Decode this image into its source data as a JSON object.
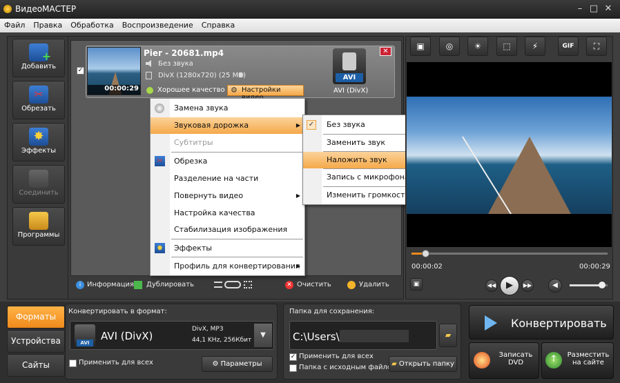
{
  "window": {
    "title": "ВидеоМАСТЕР",
    "min": "–",
    "max": "□",
    "close": "✕"
  },
  "menubar": [
    "Файл",
    "Правка",
    "Обработка",
    "Воспроизведение",
    "Справка"
  ],
  "left_buttons": [
    {
      "label": "Добавить",
      "icon": "film-add-icon"
    },
    {
      "label": "Обрезать",
      "icon": "film-cut-icon"
    },
    {
      "label": "Эффекты",
      "icon": "effects-star-icon"
    },
    {
      "label": "Соединить",
      "icon": "film-join-icon",
      "disabled": true
    },
    {
      "label": "Программы",
      "icon": "programs-icon"
    }
  ],
  "file": {
    "name": "Pier - 20681.mp4",
    "audio": "Без звука",
    "info": "DivX (1280x720) (25 МБ)",
    "duration": "00:00:29",
    "quality": "Хорошее качество",
    "video_settings": "Настройки видео",
    "format_badge": "AVI",
    "format_label": "AVI (DivX)",
    "checked": true
  },
  "context_menu": [
    {
      "label": "Замена звука",
      "icon": "audio-replace-icon"
    },
    {
      "label": "Звуковая дорожка",
      "highlight": true,
      "submenu": true
    },
    {
      "label": "Субтитры",
      "disabled": true
    },
    {
      "label": "Обрезка",
      "icon": "cut-icon"
    },
    {
      "label": "Разделение на части"
    },
    {
      "label": "Повернуть видео",
      "submenu": true
    },
    {
      "label": "Настройка качества"
    },
    {
      "label": "Стабилизация изображения"
    },
    {
      "label": "Эффекты",
      "icon": "effects-icon"
    },
    {
      "label": "Профиль для конвертирования",
      "submenu": true
    }
  ],
  "submenu": [
    {
      "label": "Без звука",
      "checked": true
    },
    {
      "label": "Заменить звук"
    },
    {
      "label": "Наложить звук",
      "highlight": true
    },
    {
      "label": "Запись с микрофона"
    },
    {
      "label": "Изменить громкость"
    }
  ],
  "list_toolbar": {
    "info": "Информация",
    "duplicate": "Дублировать",
    "clear": "Очистить",
    "delete": "Удалить"
  },
  "player": {
    "current": "00:00:02",
    "total": "00:00:29",
    "progress": 0.069,
    "volume": 0.85,
    "gif": "GIF"
  },
  "tabs": [
    {
      "label": "Форматы",
      "active": true
    },
    {
      "label": "Устройства"
    },
    {
      "label": "Сайты"
    }
  ],
  "convert_to": {
    "heading": "Конвертировать в формат:",
    "format": "AVI (DivX)",
    "badge": "AVI",
    "codecs": "DivX, MP3",
    "audio": "44,1 KHz, 256Кбит",
    "apply_all": "Применить для всех",
    "params": "Параметры"
  },
  "save_folder": {
    "heading": "Папка для сохранения:",
    "path": "C:\\Users\\.",
    "apply_all": "Применить для всех",
    "apply_checked": true,
    "source_folder": "Папка с исходным файлом",
    "open": "Открыть папку"
  },
  "actions": {
    "convert": "Конвертировать",
    "burn": "Записать DVD",
    "publish": "Разместить на сайте"
  }
}
